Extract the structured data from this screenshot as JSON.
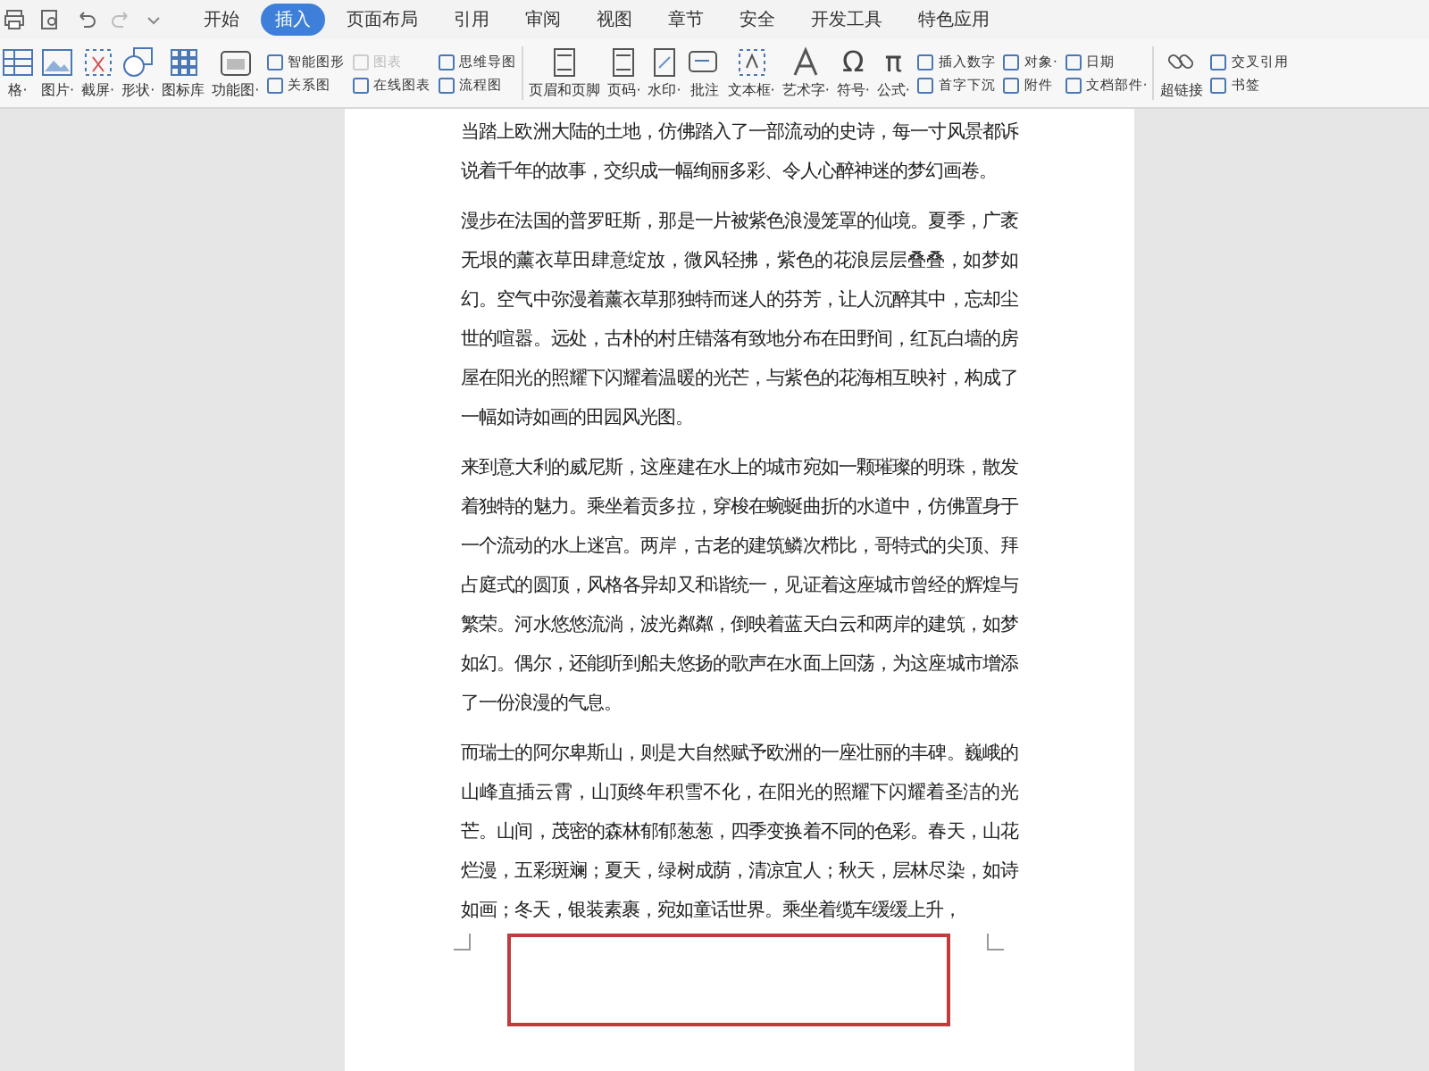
{
  "tabs": [
    {
      "label": "开始",
      "selected": false
    },
    {
      "label": "插入",
      "selected": true
    },
    {
      "label": "页面布局",
      "selected": false
    },
    {
      "label": "引用",
      "selected": false
    },
    {
      "label": "审阅",
      "selected": false
    },
    {
      "label": "视图",
      "selected": false
    },
    {
      "label": "章节",
      "selected": false
    },
    {
      "label": "安全",
      "selected": false
    },
    {
      "label": "开发工具",
      "selected": false
    },
    {
      "label": "特色应用",
      "selected": false
    }
  ],
  "ribbon": [
    {
      "kind": "large",
      "label": "格·"
    },
    {
      "kind": "large",
      "label": "图片·"
    },
    {
      "kind": "large",
      "label": "截屏·"
    },
    {
      "kind": "large",
      "label": "形状·"
    },
    {
      "kind": "large",
      "label": "图标库"
    },
    {
      "kind": "large",
      "label": "功能图·"
    },
    {
      "kind": "stack",
      "items": [
        {
          "label": "智能图形",
          "disabled": false
        },
        {
          "label": "关系图",
          "disabled": false
        }
      ]
    },
    {
      "kind": "stack",
      "items": [
        {
          "label": "图表",
          "disabled": true
        },
        {
          "label": "在线图表",
          "disabled": false
        }
      ]
    },
    {
      "kind": "stack",
      "items": [
        {
          "label": "思维导图",
          "disabled": false
        },
        {
          "label": "流程图",
          "disabled": false
        }
      ]
    },
    {
      "kind": "separator"
    },
    {
      "kind": "large",
      "label": "页眉和页脚"
    },
    {
      "kind": "large",
      "label": "页码·"
    },
    {
      "kind": "large",
      "label": "水印·"
    },
    {
      "kind": "large",
      "label": "批注"
    },
    {
      "kind": "large",
      "label": "文本框·"
    },
    {
      "kind": "large",
      "label": "艺术字·"
    },
    {
      "kind": "large",
      "label": "符号·",
      "glyph": "Ω"
    },
    {
      "kind": "large",
      "label": "公式·",
      "glyph": "π"
    },
    {
      "kind": "stack",
      "items": [
        {
          "label": "插入数字",
          "disabled": false
        },
        {
          "label": "首字下沉",
          "disabled": false
        }
      ]
    },
    {
      "kind": "stack",
      "items": [
        {
          "label": "对象·",
          "disabled": false
        },
        {
          "label": "附件",
          "disabled": false
        }
      ]
    },
    {
      "kind": "stack",
      "items": [
        {
          "label": "日期",
          "disabled": false
        },
        {
          "label": "文档部件·",
          "disabled": false
        }
      ]
    },
    {
      "kind": "separator"
    },
    {
      "kind": "large",
      "label": "超链接"
    },
    {
      "kind": "stack",
      "items": [
        {
          "label": "交叉引用",
          "disabled": false
        },
        {
          "label": "书签",
          "disabled": false
        }
      ]
    }
  ],
  "document": {
    "paragraphs": [
      "当踏上欧洲大陆的土地，仿佛踏入了一部流动的史诗，每一寸风景都诉说着千年的故事，交织成一幅绚丽多彩、令人心醉神迷的梦幻画卷。",
      "漫步在法国的普罗旺斯，那是一片被紫色浪漫笼罩的仙境。夏季，广袤无垠的薰衣草田肆意绽放，微风轻拂，紫色的花浪层层叠叠，如梦如幻。空气中弥漫着薰衣草那独特而迷人的芬芳，让人沉醉其中，忘却尘世的喧嚣。远处，古朴的村庄错落有致地分布在田野间，红瓦白墙的房屋在阳光的照耀下闪耀着温暖的光芒，与紫色的花海相互映衬，构成了一幅如诗如画的田园风光图。",
      "来到意大利的威尼斯，这座建在水上的城市宛如一颗璀璨的明珠，散发着独特的魅力。乘坐着贡多拉，穿梭在蜿蜒曲折的水道中，仿佛置身于一个流动的水上迷宫。两岸，古老的建筑鳞次栉比，哥特式的尖顶、拜占庭式的圆顶，风格各异却又和谐统一，见证着这座城市曾经的辉煌与繁荣。河水悠悠流淌，波光粼粼，倒映着蓝天白云和两岸的建筑，如梦如幻。偶尔，还能听到船夫悠扬的歌声在水面上回荡，为这座城市增添了一份浪漫的气息。",
      "而瑞士的阿尔卑斯山，则是大自然赋予欧洲的一座壮丽的丰碑。巍峨的山峰直插云霄，山顶终年积雪不化，在阳光的照耀下闪耀着圣洁的光芒。山间，茂密的森林郁郁葱葱，四季变换着不同的色彩。春天，山花烂漫，五彩斑斓；夏天，绿树成荫，清凉宜人；秋天，层林尽染，如诗如画；冬天，银装素裹，宛如童话世界。乘坐着缆车缓缓上升，"
    ]
  }
}
